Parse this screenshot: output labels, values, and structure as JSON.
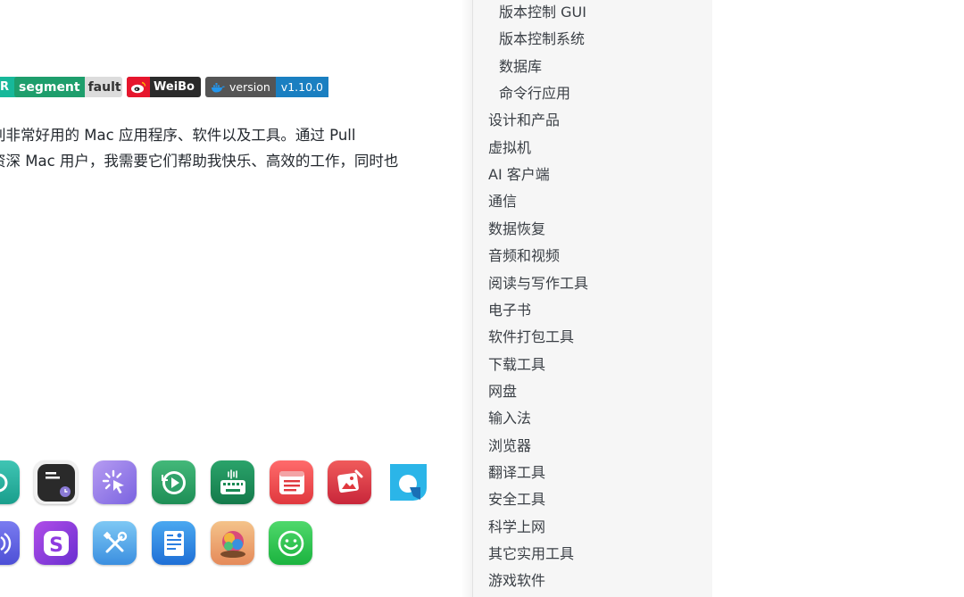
{
  "badges": {
    "first_right": "R",
    "segment_left": "segment",
    "segment_right": "fault",
    "weibo": "WeiBo",
    "version_left": "version",
    "version_right": "v1.10.0"
  },
  "intro": {
    "line1": "别非常好用的 Mac 应用程序、软件以及工具。通过 Pull",
    "line2": "资深 Mac 用户，我需要它们帮助我快乐、高效的工作，同时也"
  },
  "app_icons": [
    {
      "name": "teal-app-icon"
    },
    {
      "name": "terminal-clock-icon"
    },
    {
      "name": "cursor-click-icon"
    },
    {
      "name": "replay-icon"
    },
    {
      "name": "keyboard-voice-icon"
    },
    {
      "name": "checklist-icon"
    },
    {
      "name": "photo-edit-icon"
    },
    {
      "name": "edge-style-icon"
    },
    {
      "name": "audio-wave-icon"
    },
    {
      "name": "letter-s-icon"
    },
    {
      "name": "tools-icon"
    },
    {
      "name": "document-form-icon"
    },
    {
      "name": "colorful-art-icon"
    },
    {
      "name": "smiley-icon"
    }
  ],
  "sidebar": {
    "items": [
      {
        "label": "版本控制 GUI",
        "level": 2
      },
      {
        "label": "版本控制系统",
        "level": 2
      },
      {
        "label": "数据库",
        "level": 2
      },
      {
        "label": "命令行应用",
        "level": 2
      },
      {
        "label": "设计和产品",
        "level": 1
      },
      {
        "label": "虚拟机",
        "level": 1
      },
      {
        "label": "AI 客户端",
        "level": 1
      },
      {
        "label": "通信",
        "level": 1
      },
      {
        "label": "数据恢复",
        "level": 1
      },
      {
        "label": "音频和视频",
        "level": 1
      },
      {
        "label": "阅读与写作工具",
        "level": 1
      },
      {
        "label": "电子书",
        "level": 1
      },
      {
        "label": "软件打包工具",
        "level": 1
      },
      {
        "label": "下载工具",
        "level": 1
      },
      {
        "label": "网盘",
        "level": 1
      },
      {
        "label": "输入法",
        "level": 1
      },
      {
        "label": "浏览器",
        "level": 1
      },
      {
        "label": "翻译工具",
        "level": 1
      },
      {
        "label": "安全工具",
        "level": 1
      },
      {
        "label": "科学上网",
        "level": 1
      },
      {
        "label": "其它实用工具",
        "level": 1
      },
      {
        "label": "游戏软件",
        "level": 1
      }
    ]
  }
}
